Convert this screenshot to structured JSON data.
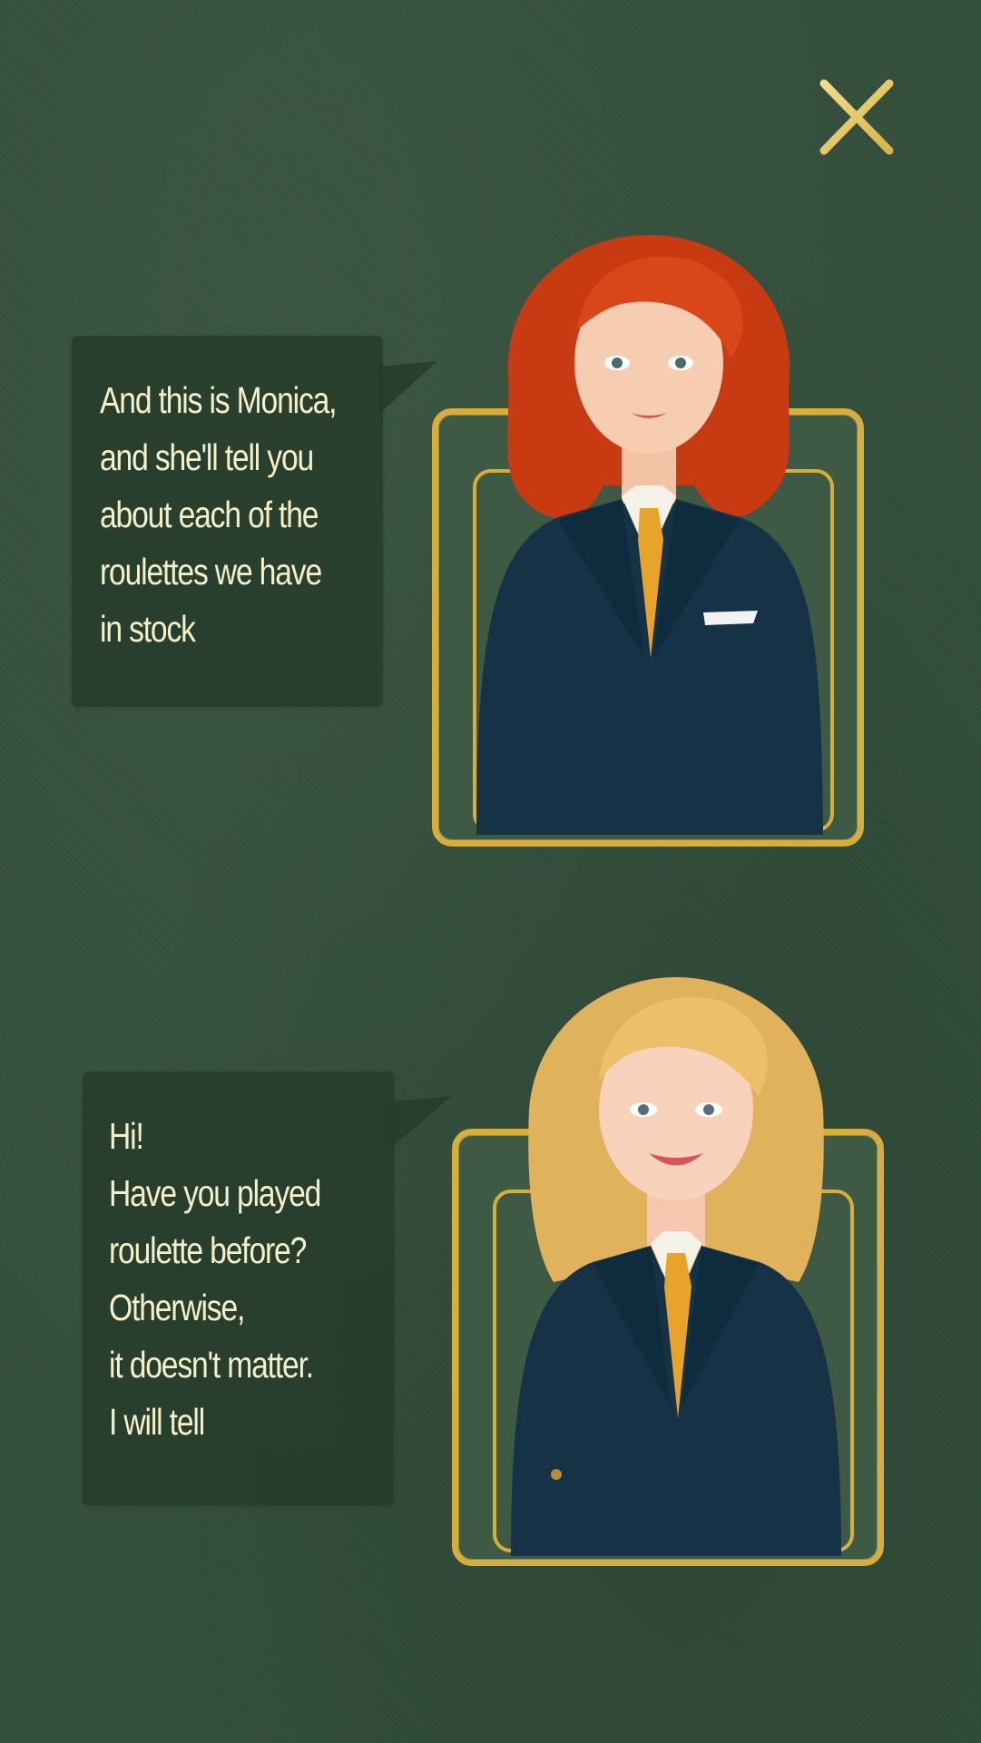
{
  "close_icon": "close-icon",
  "colors": {
    "background": "#344f3c",
    "bubble": "#263c2c",
    "gold_frame": "#d7ad3c",
    "text": "#f6f0c8"
  },
  "dialogs": [
    {
      "speaker_avatar": "redhead-woman-portrait",
      "text": "And this is Monica,\nand she'll tell you\nabout each of the\nroulettes we have\nin stock"
    },
    {
      "speaker_avatar": "blonde-woman-portrait",
      "text": "Hi!\nHave you played\nroulette before?\nOtherwise,\nit doesn't matter.\nI will tell"
    }
  ]
}
